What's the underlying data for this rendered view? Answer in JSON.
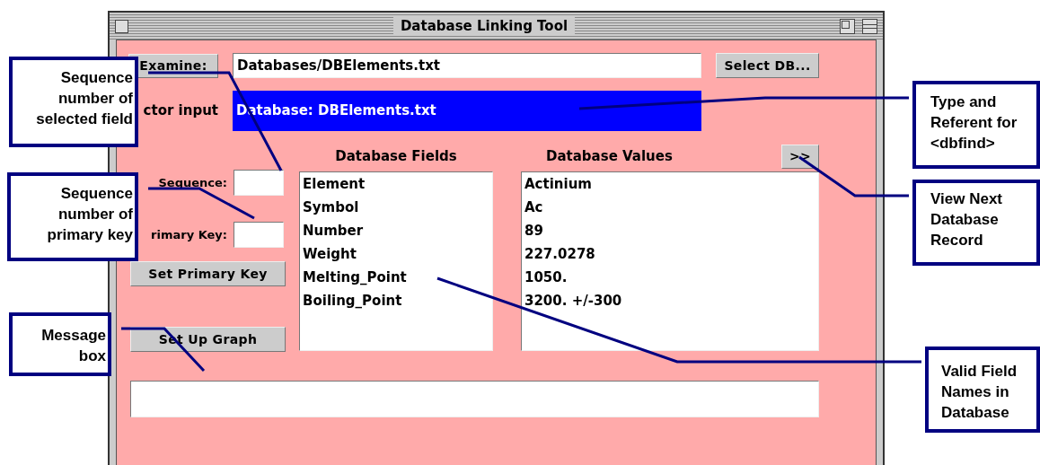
{
  "window": {
    "title": "Database Linking Tool"
  },
  "examine_button": "Examine:",
  "path_field": {
    "value": "Databases/DBElements.txt"
  },
  "select_db_button": "Select DB...",
  "selector": {
    "label": "ctor input",
    "value": "Database: DBElements.txt"
  },
  "sequence": {
    "label": "Sequence:"
  },
  "primary_key": {
    "label": "rimary Key:"
  },
  "buttons": [
    "Set Primary Key",
    "Set Up Graph"
  ],
  "fields": {
    "title": "Database Fields",
    "items": [
      "Element",
      "Symbol",
      "Number",
      "Weight",
      "Melting_Point",
      "Boiling_Point"
    ]
  },
  "values": {
    "title": "Database Values",
    "next_button": ">>",
    "items": [
      "Actinium",
      "Ac",
      "89",
      "227.0278",
      "1050.",
      "3200. +/-300"
    ]
  },
  "callouts": [
    {
      "text": "Sequence number of selected field"
    },
    {
      "text": "Sequence number of primary key"
    },
    {
      "text": "Message box"
    },
    {
      "text": "Type and Referent for <dbfind>"
    },
    {
      "text": "View Next Database Record"
    },
    {
      "text": "Valid Field Names in Database"
    }
  ]
}
